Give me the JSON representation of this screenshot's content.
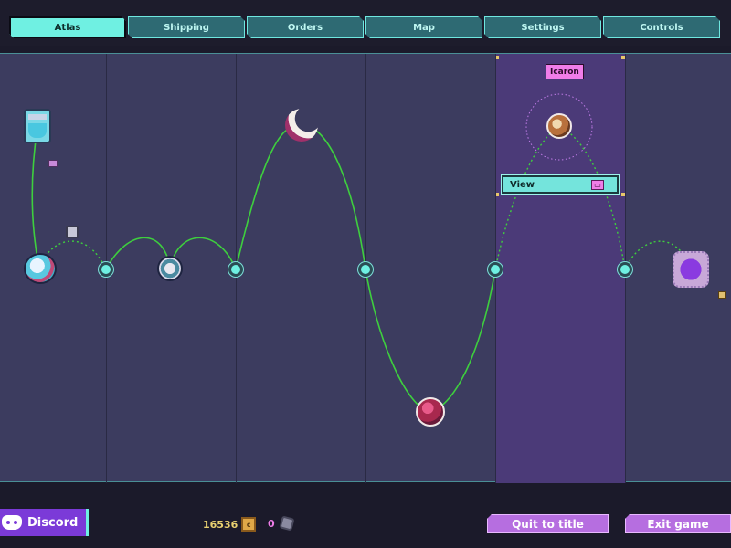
{
  "tabs": [
    {
      "label": "Atlas",
      "active": true
    },
    {
      "label": "Shipping",
      "active": false
    },
    {
      "label": "Orders",
      "active": false
    },
    {
      "label": "Map",
      "active": false
    },
    {
      "label": "Settings",
      "active": false
    },
    {
      "label": "Controls",
      "active": false
    }
  ],
  "map": {
    "selected_planet": "Icaron",
    "view_button_label": "View",
    "view_button_key": "▭",
    "route_color": "#3ecf3e"
  },
  "footer": {
    "discord_label": "Discord",
    "credits": "16536",
    "credits_icon": "coin-icon",
    "parts": "0",
    "parts_icon": "gear-icon",
    "quit_label": "Quit to title",
    "exit_label": "Exit game"
  },
  "colors": {
    "accent": "#6ff0e2",
    "panel": "#3c3c5f",
    "selected_column": "#4b3a78",
    "button": "#b66ee0",
    "discord": "#7b3ad8"
  }
}
